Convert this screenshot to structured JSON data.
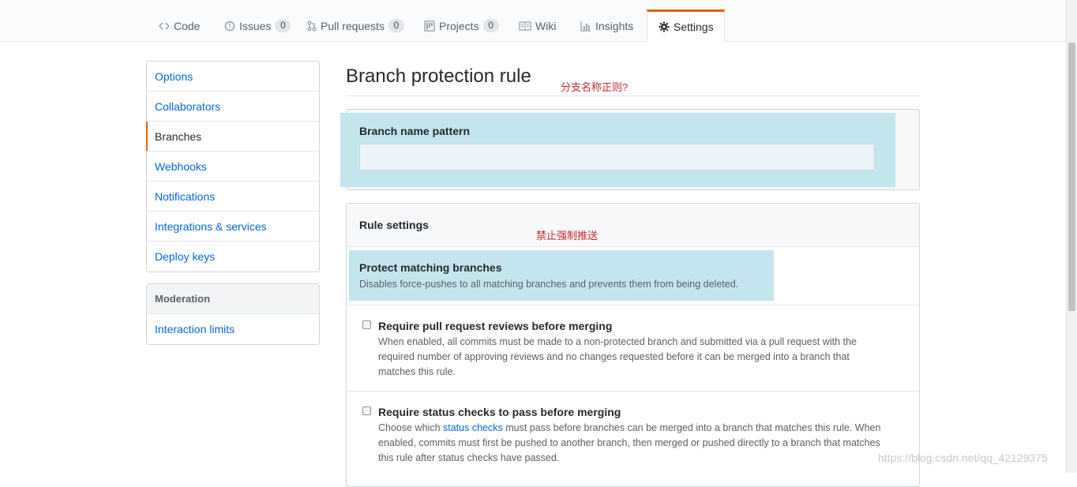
{
  "nav": {
    "tabs": [
      {
        "label": "Code",
        "icon": "code-icon",
        "count": null
      },
      {
        "label": "Issues",
        "icon": "issue-icon",
        "count": "0"
      },
      {
        "label": "Pull requests",
        "icon": "pull-request-icon",
        "count": "0"
      },
      {
        "label": "Projects",
        "icon": "project-icon",
        "count": "0"
      },
      {
        "label": "Wiki",
        "icon": "book-icon",
        "count": null
      },
      {
        "label": "Insights",
        "icon": "graph-icon",
        "count": null
      },
      {
        "label": "Settings",
        "icon": "gear-icon",
        "count": null,
        "selected": true
      }
    ]
  },
  "sidebar": {
    "items": [
      {
        "label": "Options"
      },
      {
        "label": "Collaborators"
      },
      {
        "label": "Branches",
        "selected": true
      },
      {
        "label": "Webhooks"
      },
      {
        "label": "Notifications"
      },
      {
        "label": "Integrations & services"
      },
      {
        "label": "Deploy keys"
      }
    ],
    "moderation": {
      "heading": "Moderation",
      "items": [
        {
          "label": "Interaction limits"
        }
      ]
    }
  },
  "main": {
    "title": "Branch protection rule",
    "annotation_pattern": "分支名称正则?",
    "pattern": {
      "label": "Branch name pattern",
      "value": ""
    },
    "rules": {
      "heading": "Rule settings",
      "annotation_force_push": "禁止强制推送",
      "protect": {
        "title": "Protect matching branches",
        "description": "Disables force-pushes to all matching branches and prevents them from being deleted."
      },
      "reviews": {
        "title": "Require pull request reviews before merging",
        "description": [
          "When enabled, all commits must be made to a non-protected branch and submitted via a pull request with the",
          "required number of approving reviews and no changes requested before it can be merged into a branch that",
          "matches this rule."
        ]
      },
      "status_checks": {
        "title": "Require status checks to pass before merging",
        "description_pre": "Choose which ",
        "description_link": "status checks",
        "description_post": " must pass before branches can be merged into a branch that matches this rule. When",
        "description_lines": [
          "enabled, commits must first be pushed to another branch, then merged or pushed directly to a branch that matches",
          "this rule after status checks have passed."
        ]
      }
    }
  },
  "watermark": "https://blog.csdn.net/qq_42129375",
  "colors": {
    "accent": "#e36209",
    "link": "#0366d6",
    "highlight": "#c3e6ee",
    "annotation": "#cb2431"
  }
}
